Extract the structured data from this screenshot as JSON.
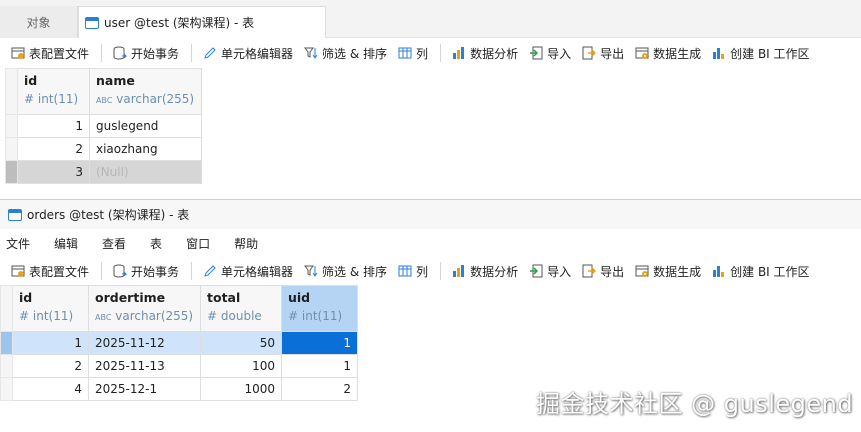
{
  "top_window": {
    "tabs": [
      {
        "label": "对象"
      },
      {
        "label": "user @test (架构课程) - 表"
      }
    ],
    "toolbar": {
      "table_config": "表配置文件",
      "begin_tx": "开始事务",
      "cell_editor": "单元格编辑器",
      "filter_sort": "筛选 & 排序",
      "columns": "列",
      "data_analysis": "数据分析",
      "import": "导入",
      "export": "导出",
      "data_gen": "数据生成",
      "bi": "创建 BI 工作区"
    },
    "grid": {
      "columns": [
        {
          "name": "id",
          "type": "int(11)",
          "type_icon": "#"
        },
        {
          "name": "name",
          "type": "varchar(255)",
          "type_icon": "ABC"
        }
      ],
      "rows": [
        {
          "id": "1",
          "name": "guslegend"
        },
        {
          "id": "2",
          "name": "xiaozhang"
        },
        {
          "id": "3",
          "name": "(Null)"
        }
      ]
    }
  },
  "bottom_window": {
    "title": "orders @test (架构课程) - 表",
    "menu": [
      "文件",
      "编辑",
      "查看",
      "表",
      "窗口",
      "帮助"
    ],
    "toolbar": {
      "table_config": "表配置文件",
      "begin_tx": "开始事务",
      "cell_editor": "单元格编辑器",
      "filter_sort": "筛选 & 排序",
      "columns": "列",
      "data_analysis": "数据分析",
      "import": "导入",
      "export": "导出",
      "data_gen": "数据生成",
      "bi": "创建 BI 工作区"
    },
    "grid": {
      "columns": [
        {
          "name": "id",
          "type": "int(11)",
          "type_icon": "#"
        },
        {
          "name": "ordertime",
          "type": "varchar(255)",
          "type_icon": "ABC"
        },
        {
          "name": "total",
          "type": "double",
          "type_icon": "#"
        },
        {
          "name": "uid",
          "type": "int(11)",
          "type_icon": "#"
        }
      ],
      "rows": [
        {
          "id": "1",
          "ordertime": "2025-11-12",
          "total": "50",
          "uid": "1"
        },
        {
          "id": "2",
          "ordertime": "2025-11-13",
          "total": "100",
          "uid": "1"
        },
        {
          "id": "4",
          "ordertime": "2025-12-1",
          "total": "1000",
          "uid": "2"
        }
      ]
    }
  },
  "watermark": "掘金技术社区 @ guslegend",
  "colors": {
    "accent": "#0a6fd6",
    "selected_row": "#cfe4fa",
    "type_text": "#6b8fb3"
  }
}
